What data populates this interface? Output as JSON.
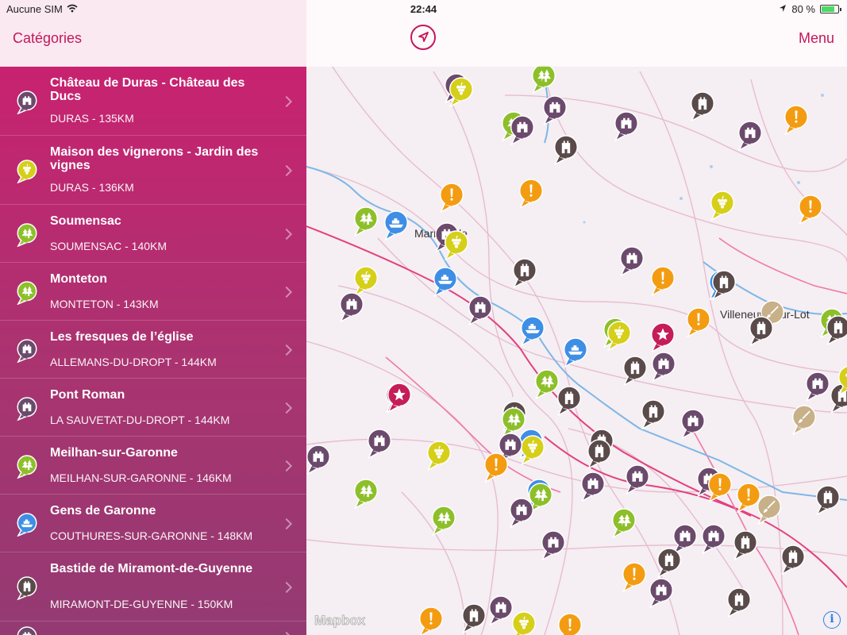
{
  "status_bar": {
    "carrier": "Aucune SIM",
    "time": "22:44",
    "battery": "80 %"
  },
  "nav": {
    "categories_label": "Catégories",
    "menu_label": "Menu"
  },
  "colors": {
    "accent": "#c2185b",
    "castle": "#6b4a6c",
    "tower": "#5a4a4a",
    "forest": "#8dbf2a",
    "vine": "#d5cf1a",
    "info": "#f39c12",
    "boat": "#3f8ee5",
    "star": "#c41d5a",
    "art": "#c8b089"
  },
  "list": [
    {
      "title": "Château de Duras - Château des Ducs",
      "subtitle": "DURAS - 135KM",
      "icon": "castle-icon",
      "color": "#6b4a6c"
    },
    {
      "title": "Maison des vignerons - Jardin des vignes",
      "subtitle": "DURAS - 136KM",
      "icon": "grape-icon",
      "color": "#d5cf1a"
    },
    {
      "title": "Soumensac",
      "subtitle": "SOUMENSAC - 140KM",
      "icon": "tree-icon",
      "color": "#8dbf2a"
    },
    {
      "title": "Monteton",
      "subtitle": "MONTETON - 143KM",
      "icon": "tree-icon",
      "color": "#8dbf2a"
    },
    {
      "title": "Les fresques de l’église",
      "subtitle": "ALLEMANS-DU-DROPT - 144KM",
      "icon": "castle-icon",
      "color": "#6b4a6c"
    },
    {
      "title": "Pont Roman",
      "subtitle": "LA SAUVETAT-DU-DROPT - 144KM",
      "icon": "castle-icon",
      "color": "#6b4a6c"
    },
    {
      "title": "Meilhan-sur-Garonne",
      "subtitle": "MEILHAN-SUR-GARONNE - 146KM",
      "icon": "tree-icon",
      "color": "#8dbf2a"
    },
    {
      "title": "Gens de Garonne",
      "subtitle": "COUTHURES-SUR-GARONNE - 148KM",
      "icon": "boat-icon",
      "color": "#3f8ee5"
    },
    {
      "title": "Bastide de Miramont-de-Guyenne",
      "subtitle": "MIRAMONT-DE-GUYENNE - 150KM",
      "icon": "tower-icon",
      "color": "#5a4a4a"
    },
    {
      "title": "",
      "subtitle": "",
      "icon": "castle-icon",
      "color": "#6b4a6c"
    }
  ],
  "map": {
    "labels": [
      "Marmande",
      "Villeneuve-sur-Lot"
    ],
    "attribution": "Mapbox",
    "info_label": "i"
  }
}
